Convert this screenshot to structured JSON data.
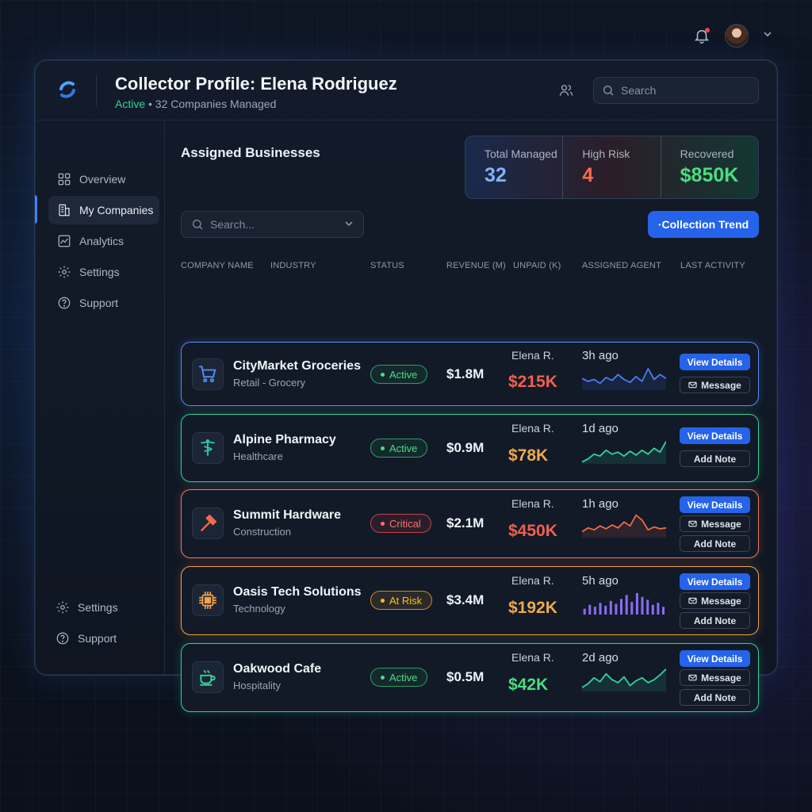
{
  "header": {
    "title": "Collector Profile: Elena Rodriguez",
    "status": "Active",
    "subtitle_rest": " • 32 Companies Managed",
    "search_placeholder": "Search"
  },
  "sidebar": {
    "items": [
      {
        "label": "Overview",
        "icon": "grid-icon"
      },
      {
        "label": "My Companies",
        "icon": "building-icon"
      },
      {
        "label": "Analytics",
        "icon": "chart-icon"
      },
      {
        "label": "Settings",
        "icon": "gear-icon"
      },
      {
        "label": "Support",
        "icon": "help-icon"
      }
    ],
    "bottom": [
      {
        "label": "Settings",
        "icon": "gear-icon"
      },
      {
        "label": "Support",
        "icon": "help-icon"
      }
    ]
  },
  "main": {
    "title": "Assigned Businesses",
    "search_placeholder": "Search...",
    "trend_button": "·Collection Trend",
    "stats": [
      {
        "label": "Total Managed",
        "value": "32"
      },
      {
        "label": "High Risk",
        "value": "4"
      },
      {
        "label": "Recovered",
        "value": "$850K"
      }
    ],
    "columns": [
      "COMPANY NAME",
      "INDUSTRY",
      "STATUS",
      "REVENUE (M)",
      "UNPAID (K)",
      "ASSIGNED AGENT",
      "LAST ACTIVITY"
    ]
  },
  "rows": [
    {
      "name": "CityMarket Groceries",
      "industry": "Retail - Grocery",
      "status": "Active",
      "revenue": "$1.8M",
      "agent": "Elena R.",
      "unpaid": "$215K",
      "activity": "3h ago",
      "buttons": [
        "View Details",
        "Message"
      ],
      "trend": [
        14,
        17,
        15,
        19,
        13,
        16,
        10,
        15,
        18,
        12,
        17,
        4,
        15,
        10,
        14
      ]
    },
    {
      "name": "Alpine Pharmacy",
      "industry": "Healthcare",
      "status": "Active",
      "revenue": "$0.9M",
      "agent": "Elena R.",
      "unpaid": "$78K",
      "activity": "1d ago",
      "buttons": [
        "View Details",
        "Add Note"
      ],
      "trend": [
        24,
        21,
        16,
        18,
        12,
        16,
        14,
        18,
        13,
        17,
        12,
        16,
        10,
        14,
        3
      ]
    },
    {
      "name": "Summit Hardware",
      "industry": "Construction",
      "status": "Critical",
      "revenue": "$2.1M",
      "agent": "Elena R.",
      "unpaid": "$450K",
      "activity": "1h ago",
      "buttons": [
        "View Details",
        "Message",
        "Add Note"
      ],
      "trend": [
        20,
        16,
        18,
        14,
        17,
        13,
        16,
        10,
        14,
        3,
        8,
        18,
        15,
        17,
        16
      ]
    },
    {
      "name": "Oasis Tech Solutions",
      "industry": "Technology",
      "status": "At Risk",
      "revenue": "$3.4M",
      "agent": "Elena R.",
      "unpaid": "$192K",
      "activity": "5h ago",
      "buttons": [
        "View Details",
        "Message",
        "Add Note"
      ],
      "trend": [
        6,
        10,
        8,
        12,
        9,
        14,
        11,
        16,
        20,
        13,
        22,
        18,
        15,
        10,
        12,
        8
      ]
    },
    {
      "name": "Oakwood Cafe",
      "industry": "Hospitality",
      "status": "Active",
      "revenue": "$0.5M",
      "agent": "Elena R.",
      "unpaid": "$42K",
      "activity": "2d ago",
      "buttons": [
        "View Details",
        "Message",
        "Add Note"
      ],
      "trend": [
        22,
        18,
        12,
        16,
        8,
        14,
        17,
        11,
        20,
        15,
        12,
        17,
        14,
        9,
        3
      ]
    }
  ]
}
